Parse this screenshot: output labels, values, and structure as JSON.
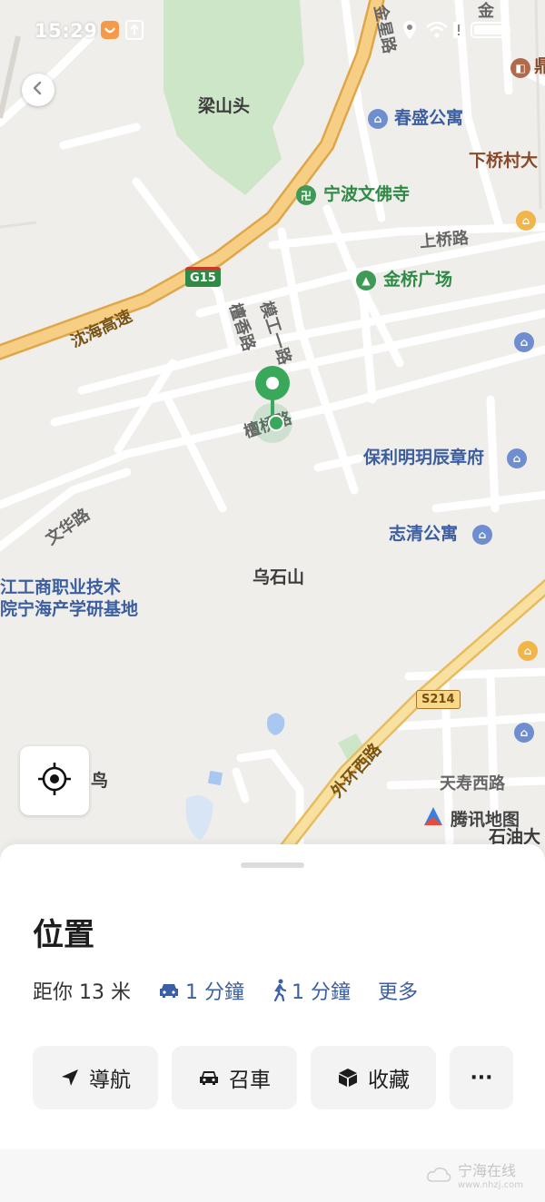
{
  "status_bar": {
    "time": "15:29"
  },
  "map": {
    "labels": {
      "liangshantou": "梁山头",
      "chunsheng": "春盛公寓",
      "xiaqiao": "下桥村大",
      "wenfosi": "宁波文佛寺",
      "shangqiao_rd": "上桥路",
      "jinqiao_sq": "金桥广场",
      "mogong_rd": "模工一路",
      "tanxiang_rd": "檀香路",
      "tanxiang2_rd": "檀桥路",
      "shenhai": "沈海高速",
      "baoli": "保利明玥辰章府",
      "zhiqing": "志清公寓",
      "wenhua_rd": "文华路",
      "wushishan": "乌石山",
      "college_1": "江工商职业技术",
      "college_2": "院宁海产学研基地",
      "waihuan": "外环西路",
      "tianshou": "天寿西路",
      "shiyou": "石油大",
      "jinxing_rd": "金星路",
      "jinxing2_rd": "金",
      "bird": "鸟",
      "ding": "鼎",
      "g15": "G15",
      "s214": "S214",
      "tencent_map": "腾讯地图"
    }
  },
  "sheet": {
    "title": "位置",
    "distance": "距你 13 米",
    "drive_time": "1 分鐘",
    "walk_time": "1 分鐘",
    "more": "更多",
    "actions": {
      "navigate": "導航",
      "taxi": "召車",
      "favorite": "收藏",
      "more": "···"
    }
  },
  "watermark": {
    "text": "宁海在线",
    "url": "www.nhzj.com"
  },
  "colors": {
    "accent_blue": "#3b5fa3",
    "marker_green": "#3aa85a",
    "highway": "#f0c46a"
  },
  "icons": [
    "back-icon",
    "locate-icon",
    "car-icon",
    "walk-icon",
    "navigate-arrow-icon",
    "taxi-icon",
    "box-icon"
  ]
}
